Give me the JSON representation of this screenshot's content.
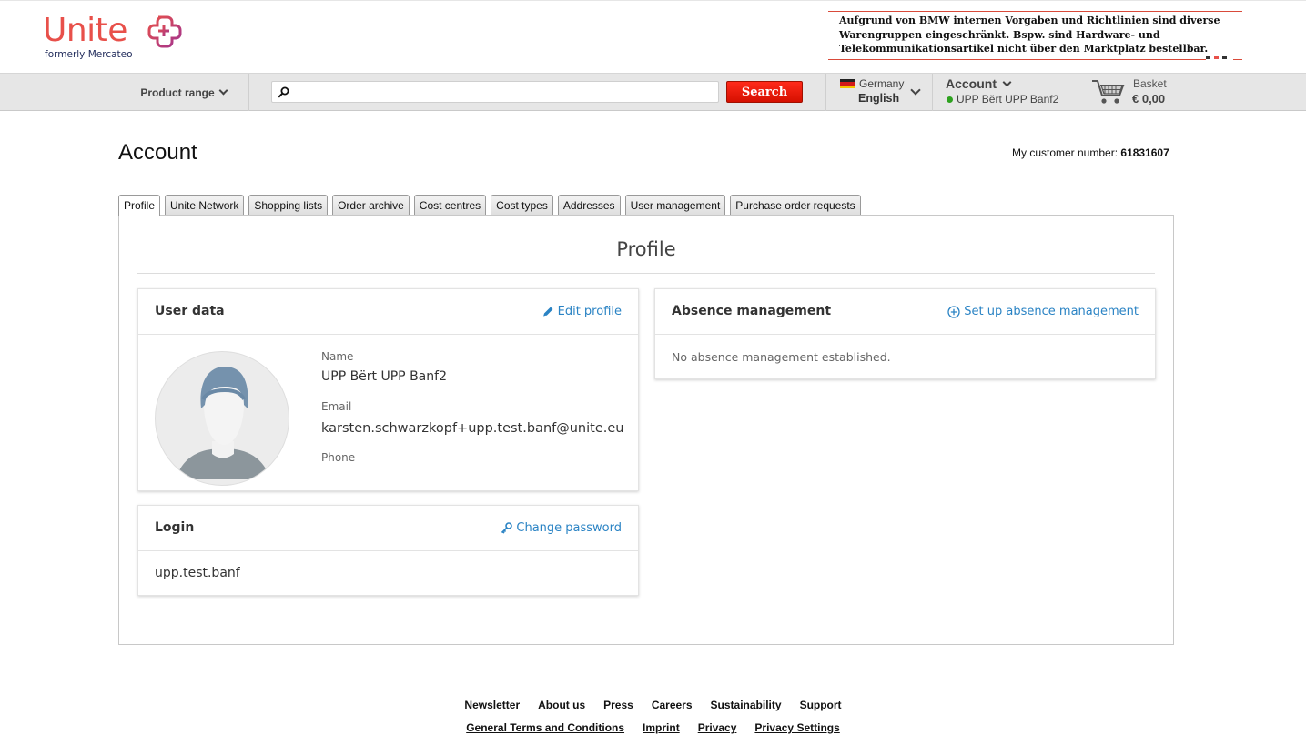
{
  "brand": {
    "name": "Unite",
    "subtitle": "formerly Mercateo",
    "color": "#e8504a"
  },
  "notice": {
    "text": "Aufgrund von BMW internen Vorgaben und Richtlinien sind diverse Warengruppen eingeschränkt. Bspw. sind Hardware- und Telekommunikationsartikel nicht über den Marktplatz bestellbar."
  },
  "nav": {
    "product_range": "Product range",
    "search_placeholder": "",
    "search_button": "Search",
    "country": "Germany",
    "language": "English",
    "account_label": "Account",
    "account_user": "UPP Bërt UPP Banf2",
    "basket_label": "Basket",
    "basket_amount": "€ 0,00"
  },
  "page": {
    "title": "Account",
    "customer_number_label": "My customer number:",
    "customer_number": "61831607"
  },
  "tabs": [
    {
      "label": "Profile",
      "active": true
    },
    {
      "label": "Unite Network"
    },
    {
      "label": "Shopping lists"
    },
    {
      "label": "Order archive"
    },
    {
      "label": "Cost centres"
    },
    {
      "label": "Cost types"
    },
    {
      "label": "Addresses"
    },
    {
      "label": "User management"
    },
    {
      "label": "Purchase order requests"
    }
  ],
  "profile": {
    "heading": "Profile",
    "user_data": {
      "title": "User data",
      "edit_label": "Edit profile",
      "name_label": "Name",
      "name": "UPP Bërt UPP Banf2",
      "email_label": "Email",
      "email": "karsten.schwarzkopf+upp.test.banf@unite.eu",
      "phone_label": "Phone",
      "phone": ""
    },
    "login": {
      "title": "Login",
      "change_password_label": "Change password",
      "username": "upp.test.banf"
    },
    "absence": {
      "title": "Absence management",
      "setup_label": "Set up absence management",
      "empty_text": "No absence management established."
    }
  },
  "footer": {
    "row1": [
      "Newsletter",
      "About us",
      "Press",
      "Careers",
      "Sustainability",
      "Support"
    ],
    "row2": [
      "General Terms and Conditions",
      "Imprint",
      "Privacy",
      "Privacy Settings"
    ]
  },
  "colors": {
    "link": "#2a83c4",
    "search_button": "#e31b0b",
    "online_status": "#2ea21f"
  },
  "icons": [
    "unite-logo-icon",
    "search-icon",
    "germany-flag-icon",
    "chevron-down-icon",
    "cart-icon",
    "pencil-icon",
    "key-icon",
    "plus-circle-icon",
    "avatar-placeholder-icon"
  ]
}
